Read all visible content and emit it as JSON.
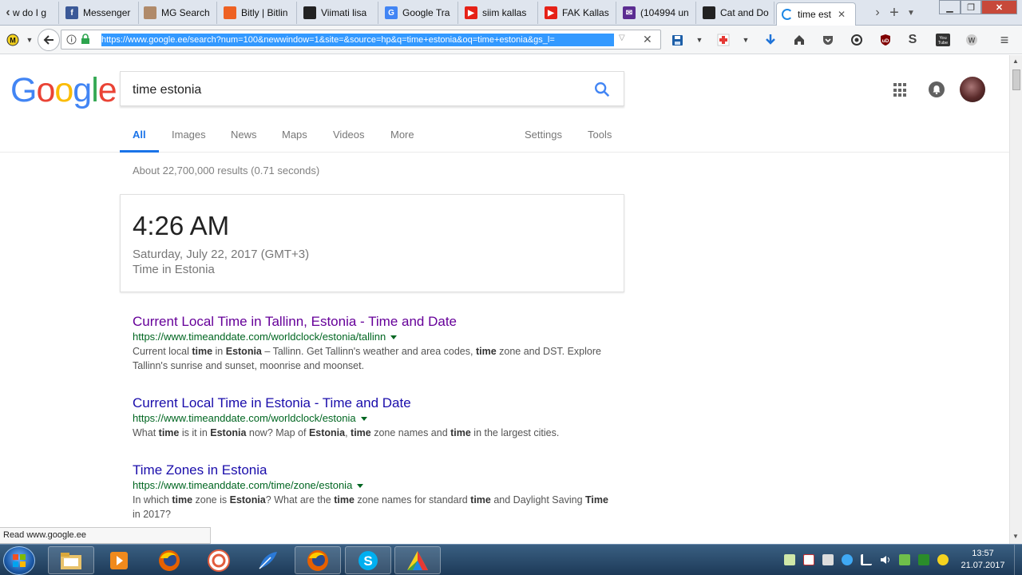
{
  "browser": {
    "tabs": [
      {
        "label": "w do I g",
        "icon": "back-arrow-tab-icon"
      },
      {
        "label": "Messenger",
        "icon": "facebook-icon",
        "color": "#3b5998"
      },
      {
        "label": "MG Search",
        "icon": "search-engine-icon",
        "color": "#b08a6a"
      },
      {
        "label": "Bitly | Bitlin",
        "icon": "bitly-icon",
        "color": "#ee6123"
      },
      {
        "label": "Viimati lisa",
        "icon": "striped-icon",
        "color": "#222222"
      },
      {
        "label": "Google Tra",
        "icon": "google-translate-icon",
        "color": "#4285f4"
      },
      {
        "label": "siim kallas",
        "icon": "youtube-icon",
        "color": "#e62117"
      },
      {
        "label": "FAK Kallas",
        "icon": "youtube-icon",
        "color": "#e62117"
      },
      {
        "label": "(104994 un",
        "icon": "mail-icon",
        "color": "#5b2c91"
      },
      {
        "label": "Cat and Do",
        "icon": "cat-icon",
        "color": "#222222"
      },
      {
        "label": "time est",
        "icon": "loading-spinner-icon",
        "color": "#1e88e5",
        "active": true
      }
    ],
    "url": "https://www.google.ee/search?num=100&newwindow=1&site=&source=hp&q=time+estonia&oq=time+estonia&gs_l="
  },
  "google": {
    "logo_text": "Google",
    "query": "time estonia",
    "tabs": [
      "All",
      "Images",
      "News",
      "Maps",
      "Videos",
      "More"
    ],
    "tools": [
      "Settings",
      "Tools"
    ],
    "stats": "About 22,700,000 results (0.71 seconds)",
    "time_card": {
      "time": "4:26 AM",
      "date": "Saturday, July 22, 2017 (GMT+3)",
      "place": "Time in Estonia"
    },
    "results": [
      {
        "title": "Current Local Time in Tallinn, Estonia - Time and Date",
        "url": "https://www.timeanddate.com/worldclock/estonia/tallinn",
        "snippet_html": "Current local <b>time</b> in <b>Estonia</b> – Tallinn. Get Tallinn's weather and area codes, <b>time</b> zone and DST. Explore Tallinn's sunrise and sunset, moonrise and moonset.",
        "visited": true
      },
      {
        "title": "Current Local Time in Estonia - Time and Date",
        "url": "https://www.timeanddate.com/worldclock/estonia",
        "snippet_html": "What <b>time</b> is it in <b>Estonia</b> now? Map of <b>Estonia</b>, <b>time</b> zone names and <b>time</b> in the largest cities.",
        "visited": false
      },
      {
        "title": "Time Zones in Estonia",
        "url": "https://www.timeanddate.com/time/zone/estonia",
        "snippet_html": "In which <b>time</b> zone is <b>Estonia</b>? What are the <b>time</b> zone names for standard <b>time</b> and Daylight Saving <b>Time</b> in 2017?",
        "visited": false
      }
    ]
  },
  "status_bar": "Read www.google.ee",
  "taskbar": {
    "time": "13:57",
    "date": "21.07.2017"
  },
  "colors": {
    "google_blue": "#4285f4",
    "google_red": "#ea4335",
    "google_yellow": "#fbbc05",
    "google_green": "#34a853",
    "link_blue": "#1a0dab",
    "visited_purple": "#660099",
    "url_green": "#006621"
  }
}
